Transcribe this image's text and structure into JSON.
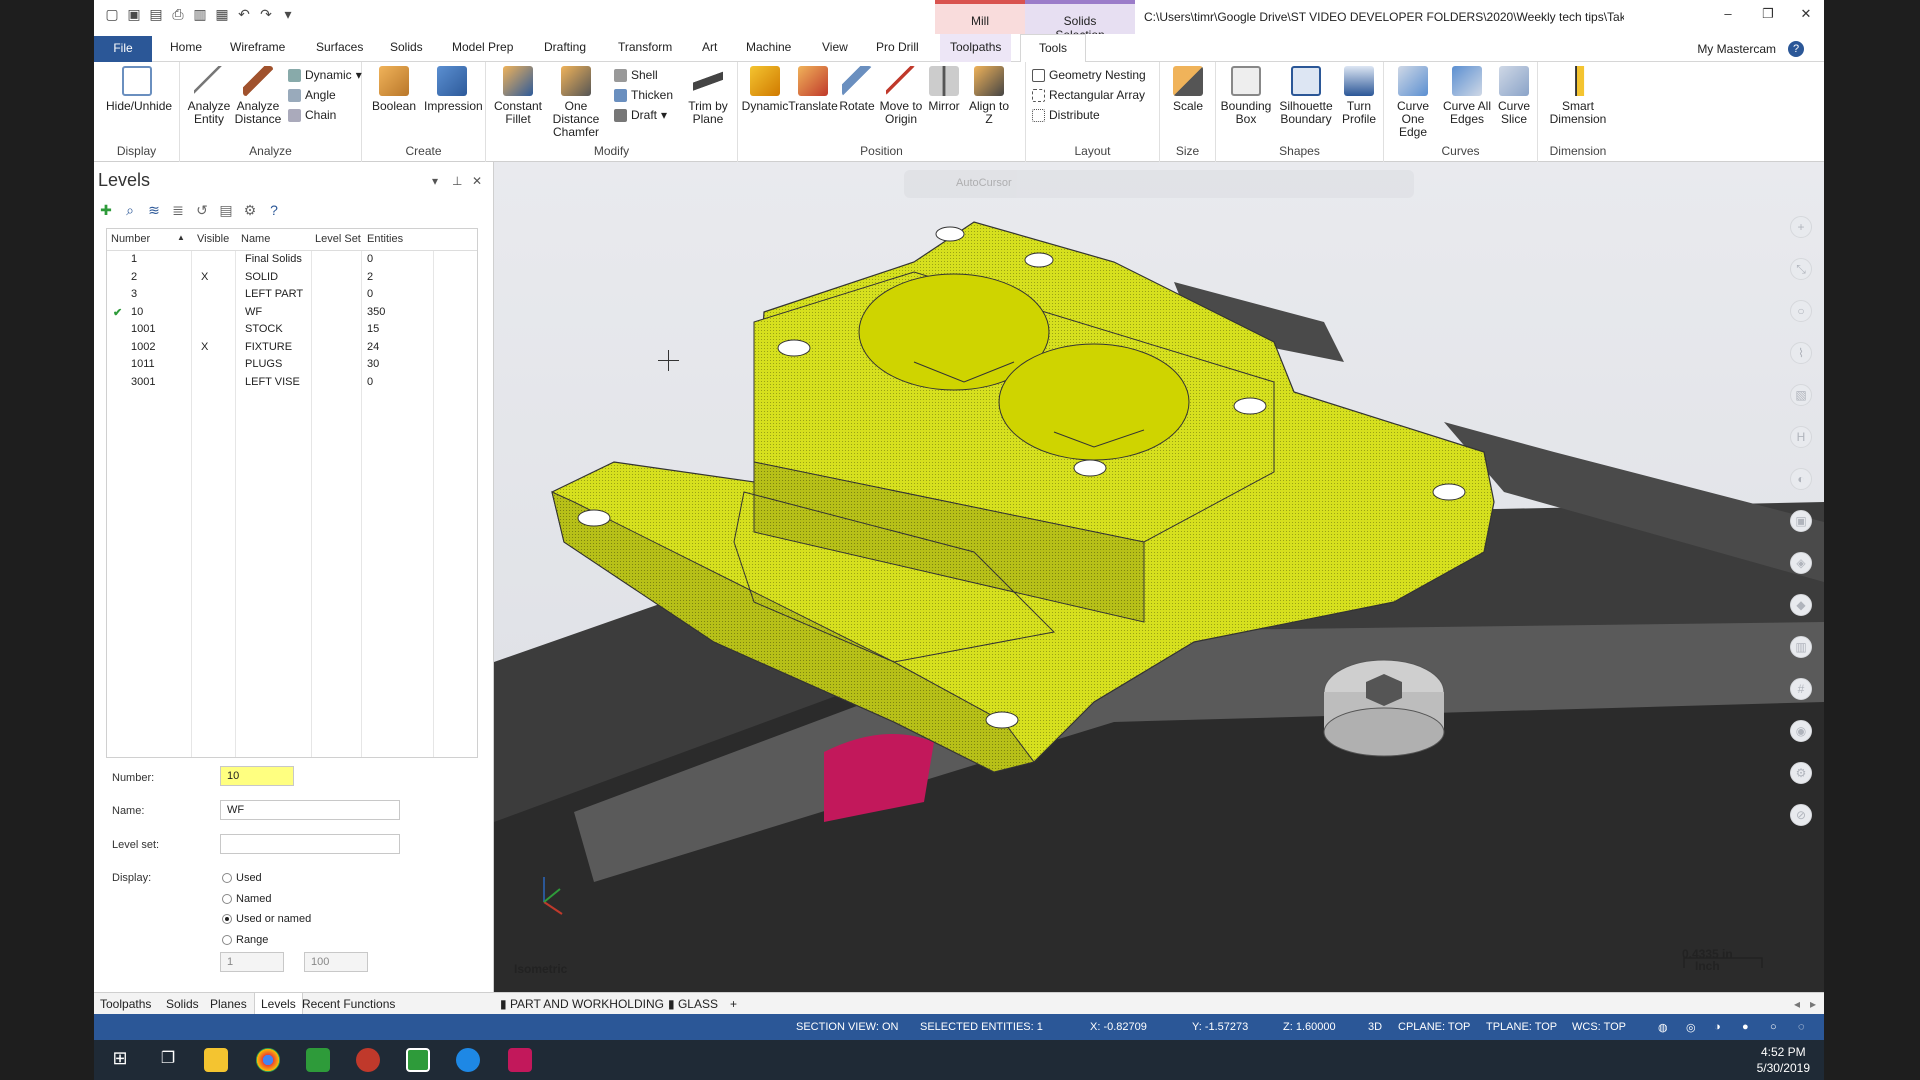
{
  "title_bar": {
    "context_tabs": [
      "Mill",
      "Solids Selection"
    ],
    "file_path": "C:\\Users\\timr\\Google Drive\\ST VIDEO DEVELOPER FOLDERS\\2020\\Weekly tech tips\\Take control of the disp..."
  },
  "ribbon_tabs": [
    "File",
    "Home",
    "Wireframe",
    "Surfaces",
    "Solids",
    "Model Prep",
    "Drafting",
    "Transform",
    "Art",
    "Machine",
    "View",
    "Pro Drill",
    "Toolpaths",
    "Tools"
  ],
  "my_mastercam": "My Mastercam",
  "ribbon": {
    "display": {
      "label": "Display",
      "hide_unhide": "Hide/Unhide"
    },
    "analyze": {
      "label": "Analyze",
      "analyze_entity": "Analyze Entity",
      "analyze_distance": "Analyze Distance",
      "dynamic": "Dynamic",
      "angle": "Angle",
      "chain": "Chain"
    },
    "create": {
      "label": "Create",
      "boolean": "Boolean",
      "impression": "Impression"
    },
    "modify": {
      "label": "Modify",
      "constant_fillet": "Constant Fillet",
      "one_distance_chamfer": "One Distance Chamfer",
      "shell": "Shell",
      "thicken": "Thicken",
      "draft": "Draft",
      "trim_by_plane": "Trim by Plane"
    },
    "position": {
      "label": "Position",
      "dynamic": "Dynamic",
      "translate": "Translate",
      "rotate": "Rotate",
      "move_to_origin": "Move to Origin",
      "mirror": "Mirror",
      "align_to_z": "Align to Z"
    },
    "layout": {
      "label": "Layout",
      "geometry_nesting": "Geometry Nesting",
      "rectangular_array": "Rectangular Array",
      "distribute": "Distribute"
    },
    "size": {
      "label": "Size",
      "scale": "Scale"
    },
    "shapes": {
      "label": "Shapes",
      "bounding_box": "Bounding Box",
      "silhouette_boundary": "Silhouette Boundary",
      "turn_profile": "Turn Profile"
    },
    "curves": {
      "label": "Curves",
      "curve_one_edge": "Curve One Edge",
      "curve_all_edges": "Curve All Edges",
      "curve_slice": "Curve Slice"
    },
    "dimension": {
      "label": "Dimension",
      "smart_dimension": "Smart Dimension"
    }
  },
  "levels_panel": {
    "title": "Levels",
    "columns": [
      "Number",
      "Visible",
      "Name",
      "Level Set",
      "Entities"
    ],
    "rows": [
      {
        "number": "1",
        "visible": "",
        "name": "Final Solids",
        "level_set": "",
        "entities": "0",
        "active": false
      },
      {
        "number": "2",
        "visible": "X",
        "name": "SOLID",
        "level_set": "",
        "entities": "2",
        "active": false
      },
      {
        "number": "3",
        "visible": "",
        "name": "LEFT PART",
        "level_set": "",
        "entities": "0",
        "active": false
      },
      {
        "number": "10",
        "visible": "",
        "name": "WF",
        "level_set": "",
        "entities": "350",
        "active": true
      },
      {
        "number": "1001",
        "visible": "",
        "name": "STOCK",
        "level_set": "",
        "entities": "15",
        "active": false
      },
      {
        "number": "1002",
        "visible": "X",
        "name": "FIXTURE",
        "level_set": "",
        "entities": "24",
        "active": false
      },
      {
        "number": "1011",
        "visible": "",
        "name": "PLUGS",
        "level_set": "",
        "entities": "30",
        "active": false
      },
      {
        "number": "3001",
        "visible": "",
        "name": "LEFT VISE",
        "level_set": "",
        "entities": "0",
        "active": false
      }
    ],
    "number_label": "Number:",
    "number_value": "10",
    "name_label": "Name:",
    "name_value": "WF",
    "level_set_label": "Level set:",
    "level_set_value": "",
    "display_label": "Display:",
    "display_options": [
      "Used",
      "Named",
      "Used or named",
      "Range"
    ],
    "display_selected": "Used or named",
    "range_from": "1",
    "range_to": "100"
  },
  "bottom_tabs": [
    "Toolpaths",
    "Solids",
    "Planes",
    "Levels",
    "Recent Functions"
  ],
  "active_bottom_tab": "Levels",
  "viewsheets": [
    "PART AND WORKHOLDING",
    "GLASS",
    "+"
  ],
  "viewport": {
    "autocursor": "AutoCursor",
    "view_name": "Isometric",
    "scale_value": "0.4335 in",
    "scale_unit": "Inch"
  },
  "status_bar": {
    "section_view": "SECTION VIEW: ON",
    "selected_entities": "SELECTED ENTITIES: 1",
    "x": "X:  -0.82709",
    "y": "Y:  -1.57273",
    "z": "Z:  1.60000",
    "mode": "3D",
    "cplane": "CPLANE: TOP",
    "tplane": "TPLANE: TOP",
    "wcs": "WCS: TOP"
  },
  "taskbar": {
    "time": "4:52 PM",
    "date": "5/30/2019"
  },
  "colors": {
    "accent": "#2b5797",
    "part_yellow": "#d6e01e",
    "plug_red": "#c2185b"
  }
}
